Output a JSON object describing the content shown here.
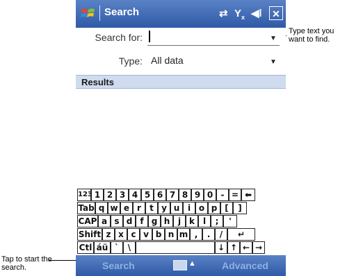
{
  "titlebar": {
    "title": "Search",
    "close": "✕",
    "icons": [
      "connectivity-icon",
      "signal-icon",
      "volume-icon"
    ]
  },
  "form": {
    "search_label": "Search for:",
    "search_value": "",
    "type_label": "Type:",
    "type_value": "All data"
  },
  "results": {
    "header": "Results"
  },
  "keyboard": {
    "rows": [
      [
        "123",
        "1",
        "2",
        "3",
        "4",
        "5",
        "6",
        "7",
        "8",
        "9",
        "0",
        "-",
        "=",
        "⬅"
      ],
      [
        "Tab",
        "q",
        "w",
        "e",
        "r",
        "t",
        "y",
        "u",
        "i",
        "o",
        "p",
        "[",
        "]"
      ],
      [
        "CAP",
        "a",
        "s",
        "d",
        "f",
        "g",
        "h",
        "j",
        "k",
        "l",
        ";",
        "'"
      ],
      [
        "Shift",
        "z",
        "x",
        "c",
        "v",
        "b",
        "n",
        "m",
        ",",
        ".",
        "/",
        "↵"
      ],
      [
        "Ctl",
        "áü",
        "`",
        "\\",
        "",
        "↓",
        "↑",
        "←",
        "→"
      ]
    ]
  },
  "bottombar": {
    "left_softkey": "Search",
    "right_softkey": "Advanced"
  },
  "callouts": {
    "right": "Type text you want to find.",
    "left": "Tap to start the search."
  }
}
